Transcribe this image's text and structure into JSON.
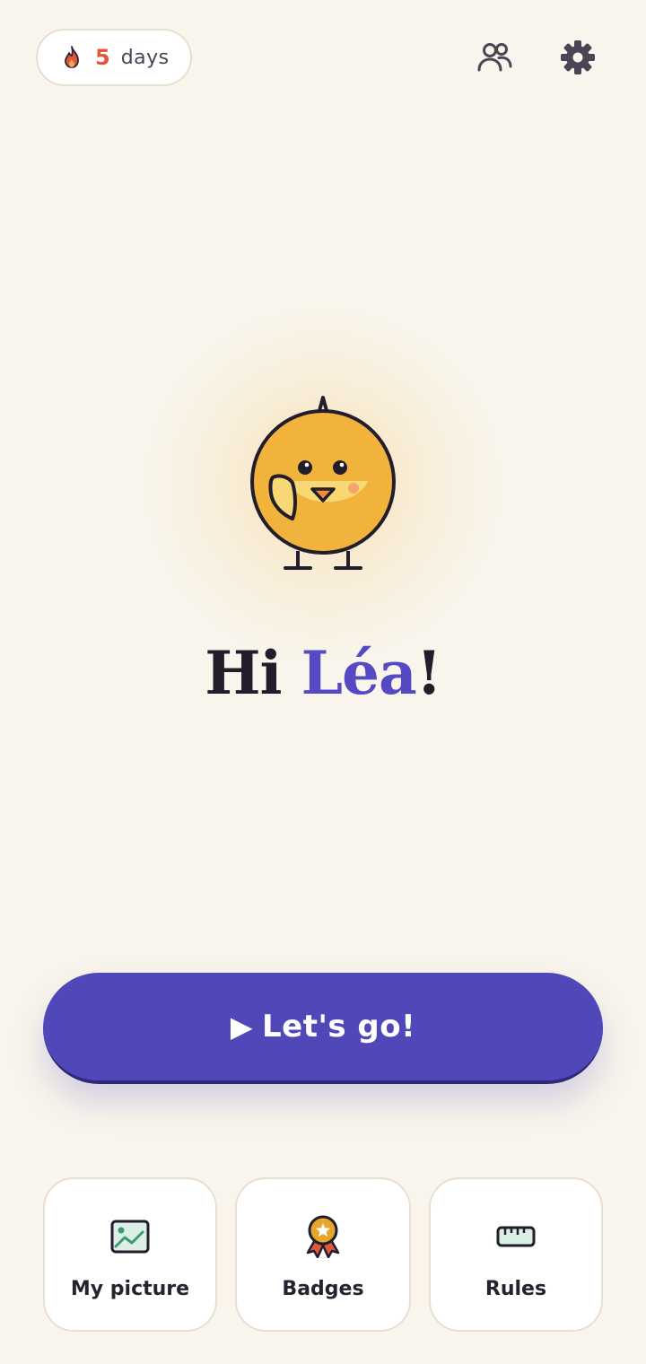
{
  "streak": {
    "count": "5",
    "unit": "days",
    "icon": "flame-icon"
  },
  "header": {
    "friends_icon": "people-icon",
    "settings_icon": "gear-icon"
  },
  "greeting": {
    "prefix": "Hi",
    "name": "Léa",
    "suffix": "!"
  },
  "cta": {
    "play_icon": "▶",
    "label": "Let's go!"
  },
  "tiles": [
    {
      "label": "My picture",
      "icon": "image-icon"
    },
    {
      "label": "Badges",
      "icon": "medal-icon"
    },
    {
      "label": "Rules",
      "icon": "ruler-icon"
    }
  ],
  "colors": {
    "background": "#f9f5ec",
    "accent": "#5048b9",
    "name_accent": "#5549c4",
    "streak": "#e0573a",
    "mascot": "#f2b33d"
  }
}
